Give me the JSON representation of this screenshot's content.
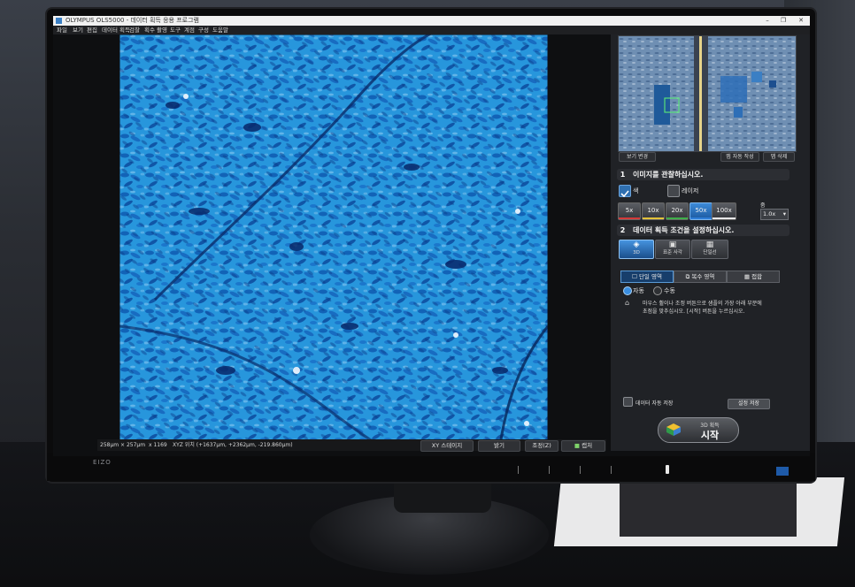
{
  "window": {
    "title": "OLYMPUS OLS5000 - 데이터 획득 응용 프로그램",
    "controls": [
      "–",
      "❐",
      "✕"
    ]
  },
  "menu": [
    "파일",
    "보기",
    "편집",
    "데이터 획득",
    "검찰",
    "획수 촬영",
    "도구",
    "계점",
    "구성",
    "도움말"
  ],
  "status": {
    "field": "258μm × 257μm",
    "zoom": "x 1169",
    "xyz": "XYZ 위치  (+1637μm, +2362μm, -219.860μm)"
  },
  "bottom_buttons": {
    "stage": "XY 스테이지",
    "brightness": "밝기",
    "adjust": "조정(Z)",
    "capture": "캡처"
  },
  "overview": {
    "view_change": "보기 변경",
    "auto_create": "맵 자동 작성",
    "delete": "맵 삭제"
  },
  "section1": {
    "num": "1",
    "title": "이미지를 관찰하십시오.",
    "color_label": "색",
    "laser_label": "레이저",
    "zoom_label": "줌",
    "zoom_value": "1.0x",
    "magnifications": [
      "5x",
      "10x",
      "20x",
      "50x",
      "100x"
    ],
    "mag_colors": [
      "#d43a3a",
      "#e3c23a",
      "#3fae4a",
      "#2f7ed8",
      "#e8e8e8"
    ],
    "active_mag": "50x"
  },
  "section2": {
    "num": "2",
    "title": "데이터 획득 조건을 설정하십시오.",
    "mode_tiles": [
      "3D",
      "표준 사각",
      "단일선"
    ],
    "tabs": [
      "단일 영역",
      "복수 영역",
      "접합"
    ],
    "radio_auto": "자동",
    "radio_manual": "수동",
    "hint": "마우스 휠이나 조정 버튼으로 샘플의 가장 아래 부분에 초점을 맞추십시오. [시작] 버튼을 누르십시오.",
    "autosave": "데이터 자동 저장",
    "settings_save": "설정 저장"
  },
  "start": {
    "small": "3D 획득",
    "big": "시작"
  },
  "monitor_brand": "EIZO",
  "colors": {
    "accent_blue": "#2f7ed8",
    "panel_bg": "#202226"
  }
}
